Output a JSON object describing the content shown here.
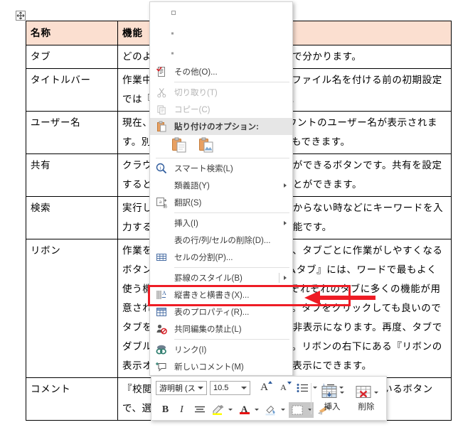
{
  "document": {
    "table": {
      "headers": [
        "名称",
        "機能"
      ],
      "rows": [
        {
          "name": "タブ",
          "text": "どのような作業をするのかは『タブ』で分かります。"
        },
        {
          "name": "タイトルバー",
          "text": "作業中のファイル名が表示されます。ファイル名を付ける前の初期設定では『文書 1』のように表示されます。"
        },
        {
          "name": "ユーザー名",
          "text": "現在、officeにログインしているアカウントのユーザー名が表示されます。別のアカウントに切り替えることもできます。"
        },
        {
          "name": "共有",
          "text": "クラウド上にファイルを保存することができるボタンです。共有を設定すると他の人とファイルを共有することができます。"
        },
        {
          "name": "検索",
          "text": "実行したい作業や機能のある場所が分からない時などにキーワードを入力すると関連する項目が表示される機能です。"
        },
        {
          "name": "リボン",
          "text": "作業を『タブ』ごとに分けているので、タブごとに作業がしやすくなるボタンがまとめられています。『ホームタブ』には、ワードで最もよく使う機能が集まっています。そして、それぞれのタブに多くの機能が用意されているので確認してみましょう。タブをクリックしても良いのでタブをダブルクリックするとリボンが非表示になります。再度、タブでダブルクリックすると再表示されます。リボンの右下にある『リボンの表示オプション』からも、リボンを非表示にできます。"
        },
        {
          "name": "コメント",
          "text": "『校閲タブ』にある『コメント』と同じように設置されているボタンで、選択した場所にコメントを挿入できます。"
        }
      ]
    },
    "table_move_handle_icon": "move-cross-icon"
  },
  "context_menu": {
    "emoji_placeholders": [
      "dot-1",
      "dot-2",
      "dot-3"
    ],
    "items": [
      {
        "label": "その他(O)...",
        "icon": "more-emoji-icon",
        "state": "normal",
        "submenu": false
      },
      {
        "label": "切り取り(T)",
        "icon": "scissors-icon",
        "state": "disabled",
        "submenu": false
      },
      {
        "label": "コピー(C)",
        "icon": "copy-icon",
        "state": "disabled",
        "submenu": false
      },
      {
        "label": "貼り付けのオプション:",
        "icon": "paste-icon",
        "state": "group",
        "submenu": false
      },
      {
        "label": "スマート検索(L)",
        "icon": "smart-lookup-icon",
        "state": "normal",
        "submenu": false
      },
      {
        "label": "類義語(Y)",
        "icon": "none",
        "state": "normal",
        "submenu": true
      },
      {
        "label": "翻訳(S)",
        "icon": "translate-icon",
        "state": "normal",
        "submenu": false
      },
      {
        "label": "挿入(I)",
        "icon": "none",
        "state": "normal",
        "submenu": true
      },
      {
        "label": "表の行/列/セルの削除(D)...",
        "icon": "none",
        "state": "normal",
        "submenu": false
      },
      {
        "label": "セルの分割(P)...",
        "icon": "split-cells-icon",
        "state": "normal",
        "submenu": false
      },
      {
        "label": "罫線のスタイル(B)",
        "icon": "none",
        "state": "normal",
        "submenu": true
      },
      {
        "label": "縦書きと横書き(X)...",
        "icon": "text-direction-icon",
        "state": "normal",
        "submenu": false
      },
      {
        "label": "表のプロパティ(R)...",
        "icon": "table-properties-icon",
        "state": "highlighted",
        "submenu": false
      },
      {
        "label": "共同編集の禁止(L)",
        "icon": "block-authors-icon",
        "state": "normal",
        "submenu": false
      },
      {
        "label": "リンク(I)",
        "icon": "link-icon",
        "state": "normal",
        "submenu": false
      },
      {
        "label": "新しいコメント(M)",
        "icon": "new-comment-icon",
        "state": "normal",
        "submenu": false
      }
    ],
    "paste_option_buttons": [
      "paste-keep-formatting-icon",
      "paste-as-picture-icon"
    ]
  },
  "annotation": {
    "highlight_color": "#ee1c25",
    "arrow_color": "#ee1c25",
    "target_item": "表のプロパティ(R)..."
  },
  "mini_toolbar": {
    "font_name": "游明朝 (ス",
    "font_size": "10.5",
    "buttons": [
      {
        "name": "grow-font",
        "glyph": "A"
      },
      {
        "name": "shrink-font",
        "glyph": "A"
      },
      {
        "name": "bullets",
        "glyph": "≔"
      },
      {
        "name": "numbering",
        "glyph": "≕"
      },
      {
        "name": "bold",
        "glyph": "B"
      },
      {
        "name": "italic",
        "glyph": "I"
      },
      {
        "name": "align",
        "glyph": "≡"
      },
      {
        "name": "highlight",
        "glyph": "ab"
      },
      {
        "name": "font-color",
        "glyph": "A"
      },
      {
        "name": "shading",
        "glyph": "◌"
      },
      {
        "name": "borders",
        "glyph": "▦"
      },
      {
        "name": "format-painter",
        "glyph": "🖌"
      }
    ],
    "table_buttons": [
      {
        "label": "挿入",
        "icon": "insert-table-icon"
      },
      {
        "label": "削除",
        "icon": "delete-table-icon"
      }
    ],
    "colors": {
      "highlight_yellow": "#ffff00",
      "font_red": "#e81313",
      "shading_blue": "#dbeaf7"
    }
  }
}
